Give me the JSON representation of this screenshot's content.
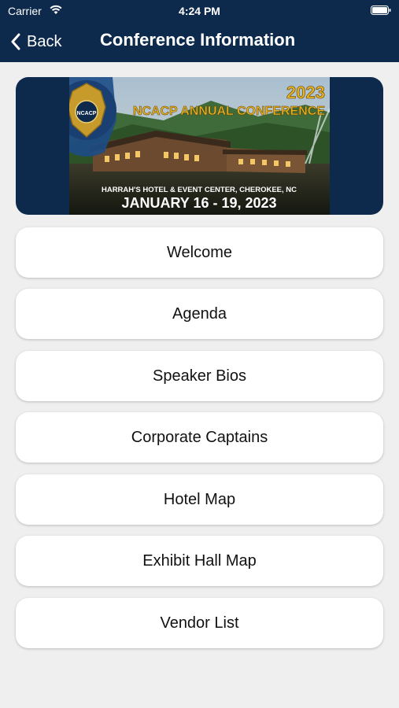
{
  "status_bar": {
    "carrier": "Carrier",
    "time": "4:24 PM",
    "wifi_icon": "wifi-icon",
    "battery_icon": "battery-icon"
  },
  "nav": {
    "back_label": "Back",
    "back_icon": "chevron-left-icon",
    "title": "Conference Information"
  },
  "banner": {
    "year": "2023",
    "title": "NCACP ANNUAL CONFERENCE",
    "badge_text": "NCACP",
    "venue": "HARRAH'S HOTEL & EVENT CENTER, CHEROKEE, NC",
    "dates": "JANUARY 16 - 19, 2023"
  },
  "menu": [
    {
      "label": "Welcome"
    },
    {
      "label": "Agenda"
    },
    {
      "label": "Speaker Bios"
    },
    {
      "label": "Corporate Captains"
    },
    {
      "label": "Hotel Map"
    },
    {
      "label": "Exhibit Hall Map"
    },
    {
      "label": "Vendor List"
    }
  ],
  "colors": {
    "navbar": "#0d2a4c",
    "background": "#efeff0",
    "banner_gold": "#e9b421",
    "button_bg": "#ffffff"
  }
}
